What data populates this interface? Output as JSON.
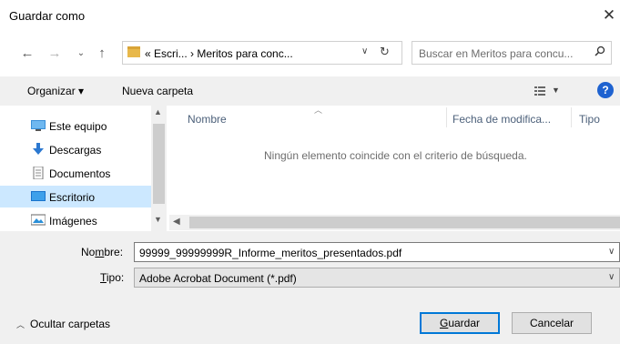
{
  "window": {
    "title": "Guardar como"
  },
  "nav": {
    "back_icon": "arrow-left",
    "forward_icon": "arrow-right",
    "recent_icon": "chevron-down",
    "up_icon": "arrow-up"
  },
  "address": {
    "path": "« Escri... › Meritos para conc..."
  },
  "search": {
    "placeholder": "Buscar en Meritos para concu..."
  },
  "toolbar": {
    "organizar": "Organizar ▾",
    "nueva_carpeta": "Nueva carpeta"
  },
  "sidebar": {
    "items": [
      {
        "label": "Este equipo",
        "icon": "computer-icon"
      },
      {
        "label": "Descargas",
        "icon": "download-icon"
      },
      {
        "label": "Documentos",
        "icon": "document-icon"
      },
      {
        "label": "Escritorio",
        "icon": "desktop-icon",
        "selected": true
      },
      {
        "label": "Imágenes",
        "icon": "image-icon"
      }
    ]
  },
  "filelist": {
    "columns": [
      "Nombre",
      "Fecha de modifica...",
      "Tipo"
    ],
    "empty_message": "Ningún elemento coincide con el criterio de búsqueda."
  },
  "form": {
    "name_label_pre": "No",
    "name_label_u": "m",
    "name_label_post": "bre:",
    "name_value": "99999_99999999R_Informe_meritos_presentados.pdf",
    "type_label_u": "T",
    "type_label_post": "ipo:",
    "type_value": "Adobe Acrobat Document (*.pdf)"
  },
  "footer": {
    "ocultar": "Ocultar carpetas",
    "guardar_u": "G",
    "guardar_post": "uardar",
    "cancelar": "Cancelar"
  },
  "colors": {
    "accent": "#0078d7",
    "selection": "#cce8ff",
    "panel": "#f0f0f0",
    "help": "#1e62d0"
  }
}
